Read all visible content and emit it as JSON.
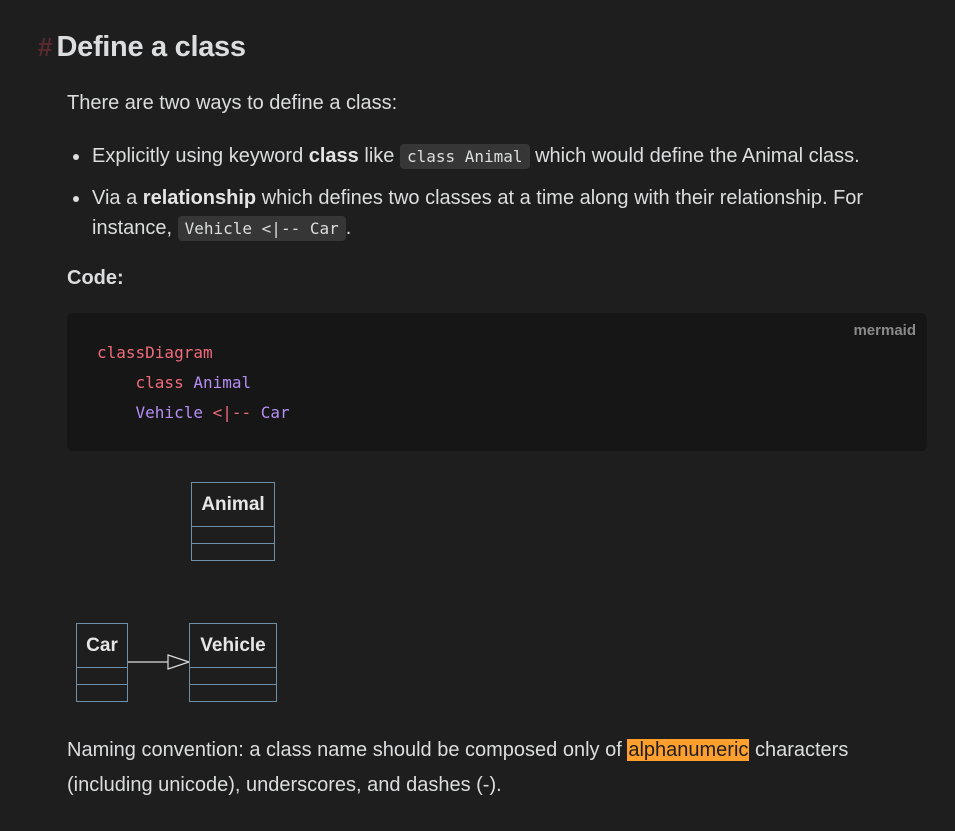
{
  "heading": {
    "hash": "#",
    "title": "Define a class"
  },
  "intro": "There are two ways to define a class:",
  "bullets": [
    {
      "pre": "Explicitly using keyword ",
      "bold": "class",
      "mid": " like ",
      "code": "class Animal",
      "post": " which would define the Animal class."
    },
    {
      "pre": "Via a ",
      "bold": "relationship",
      "mid": " which defines two classes at a time along with their relationship. For instance, ",
      "code": "Vehicle <|-- Car",
      "post": "."
    }
  ],
  "code_label": "Code:",
  "codeblock": {
    "lang": "mermaid",
    "line1": "classDiagram",
    "line2_kw": "class",
    "line2_name": "Animal",
    "line3_a": "Vehicle",
    "line3_op": "<|--",
    "line3_b": "Car"
  },
  "diagram": {
    "classes": [
      "Animal",
      "Car",
      "Vehicle"
    ]
  },
  "naming": {
    "pre": "Naming convention: a class name should be composed only of ",
    "highlight": "alphanumeric",
    "post": " characters (including unicode), underscores, and dashes (-)."
  },
  "colors": {
    "background": "#1e1e1e",
    "highlight": "#ff9f2e",
    "keyword": "#f16b7c",
    "identifier": "#b48ef5",
    "uml_border": "#6e8fa6"
  }
}
